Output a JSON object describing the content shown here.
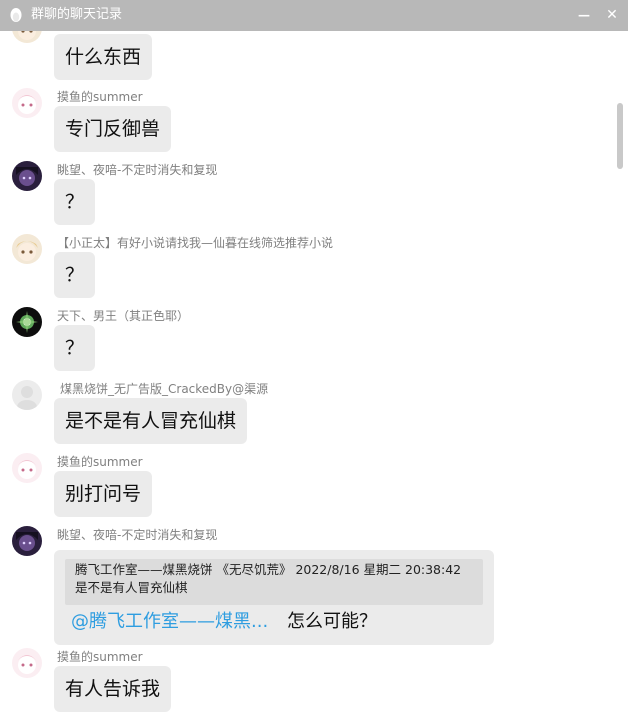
{
  "window": {
    "title": "群聊的聊天记录",
    "icon": "qq-penguin-icon",
    "minimize_icon": "minimize-icon",
    "close_icon": "close-icon",
    "minimize_glyph": "—",
    "close_glyph": "✕"
  },
  "colors": {
    "titlebar": "#b8b8b8",
    "bubble": "#ebebeb",
    "quote_box": "#dcdcdc",
    "mention": "#2e9de0",
    "sender": "#808080"
  },
  "messages": [
    {
      "sender": "",
      "text": "什么东西",
      "avatar": "anime-girl-avatar"
    },
    {
      "sender": "摸鱼的summer",
      "text": "专门反御兽",
      "avatar": "pink-anime-avatar"
    },
    {
      "sender": "眺望、夜喑-不定时消失和复现",
      "text": "？",
      "avatar": "dark-purple-avatar"
    },
    {
      "sender": "【小正太】有好小说请找我—仙暮在线筛选推荐小说",
      "text": "？",
      "avatar": "anime-girl-avatar"
    },
    {
      "sender": "天下、男王（其正色耶）",
      "text": "？",
      "avatar": "dark-glow-avatar"
    },
    {
      "sender": "煤黑烧饼_无广告版_CrackedBy@渠源",
      "text": "是不是有人冒充仙棋",
      "avatar": "default-grey-avatar"
    },
    {
      "sender": "摸鱼的summer",
      "text": "别打问号",
      "avatar": "pink-anime-avatar"
    },
    {
      "sender": "眺望、夜喑-不定时消失和复现",
      "avatar": "dark-purple-avatar",
      "quote": {
        "header": "腾飞工作室——煤黑烧饼 《无尽饥荒》 2022/8/16 星期二 20:38:42",
        "body": "是不是有人冒充仙棋"
      },
      "mention": "@腾飞工作室——煤黑...",
      "reply": "怎么可能？"
    },
    {
      "sender": "摸鱼的summer",
      "text": "有人告诉我",
      "avatar": "pink-anime-avatar"
    }
  ]
}
